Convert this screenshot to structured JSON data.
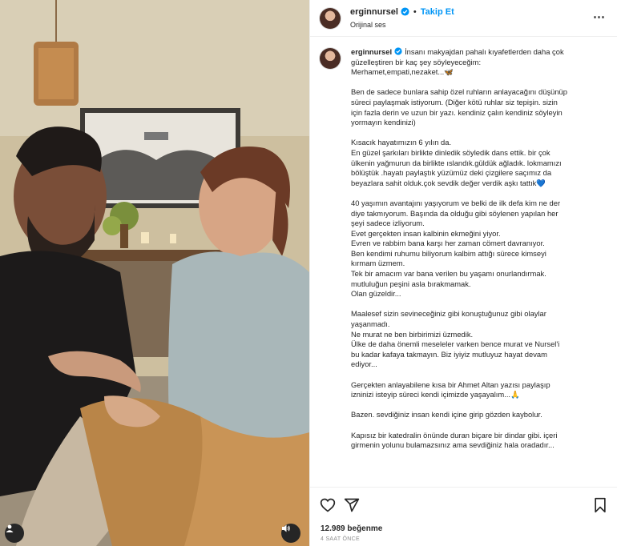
{
  "post": {
    "username": "erginnursel",
    "follow_label": "Takip Et",
    "separator": "•",
    "audio": "Orijinal ses",
    "more_icon": "⋯"
  },
  "caption": {
    "username": "erginnursel",
    "paragraphs": [
      [
        "İnsanı makyajdan pahalı kıyafetlerden daha çok",
        "güzelleştiren bir kaç şey söyleyeceğim:",
        "Merhamet,empati,nezaket...🦋"
      ],
      [
        "Ben de sadece bunlara sahip özel ruhların anlayacağını düşünüp",
        "süreci paylaşmak istiyorum. (Diğer kötü ruhlar siz tepişin. sizin",
        "için fazla derin ve uzun bir yazı. kendiniz çalın kendiniz söyleyin",
        "yormayın kendinizi)"
      ],
      [
        "Kısacık hayatımızın 6 yılın da.",
        "En güzel şarkıları birlikte dinledik söyledik dans ettik. bir çok",
        "ülkenin yağmurun da birlikte ıslandık.güldük ağladık. lokmamızı",
        "bölüştük .hayatı paylaştık yüzümüz deki çizgilere saçımız da",
        "beyazlara sahit olduk.çok sevdik değer verdik aşkı tattık💙"
      ],
      [
        "40 yaşımın avantajını yaşıyorum ve belki de ilk defa kim ne der",
        "diye takmıyorum. Başında da olduğu gibi söylenen yapılan her",
        "şeyi sadece izliyorum.",
        "Evet gerçekten insan kalbinin ekmeğini yiyor.",
        "Evren ve rabbim bana karşı her zaman cömert davranıyor.",
        "Ben kendimi ruhumu biliyorum kalbim attığı sürece kimseyi",
        "kırmam üzmem.",
        "Tek bir amacım var bana verilen bu yaşamı onurlandırmak.",
        "mutluluğun peşini asla bırakmamak.",
        "Olan güzeldir..."
      ],
      [
        "Maalesef sizin sevineceğiniz gibi konuştuğunuz gibi olaylar",
        "yaşanmadı.",
        "Ne murat ne ben birbirimizi üzmedik.",
        "Ülke de daha önemli meseleler varken bence murat ve Nursel'i",
        "bu kadar kafaya takmayın. Biz iyiyiz mutluyuz hayat devam",
        "ediyor..."
      ],
      [
        "Gerçekten anlayabilene kısa bir Ahmet Altan yazısı paylaşıp",
        "izninizi isteyip süreci kendi içimizde yaşayalım...🙏"
      ],
      [
        "Bazen. sevdiğiniz insan kendi içine girip gözden kaybolur."
      ],
      [
        "Kapısız bir katedralin önünde duran biçare bir dindar gibi. içeri",
        "girmenin yolunu bulamazsınız ama sevdiğiniz hala oradadır..."
      ]
    ]
  },
  "actions": {
    "like_icon": "heart-icon",
    "share_icon": "send-icon",
    "save_icon": "bookmark-icon",
    "likes": "12.989 beğenme",
    "time": "4 SAAT ÖNCE"
  },
  "colors": {
    "accent": "#0095f6",
    "text": "#262626",
    "muted": "#8e8e8e"
  }
}
